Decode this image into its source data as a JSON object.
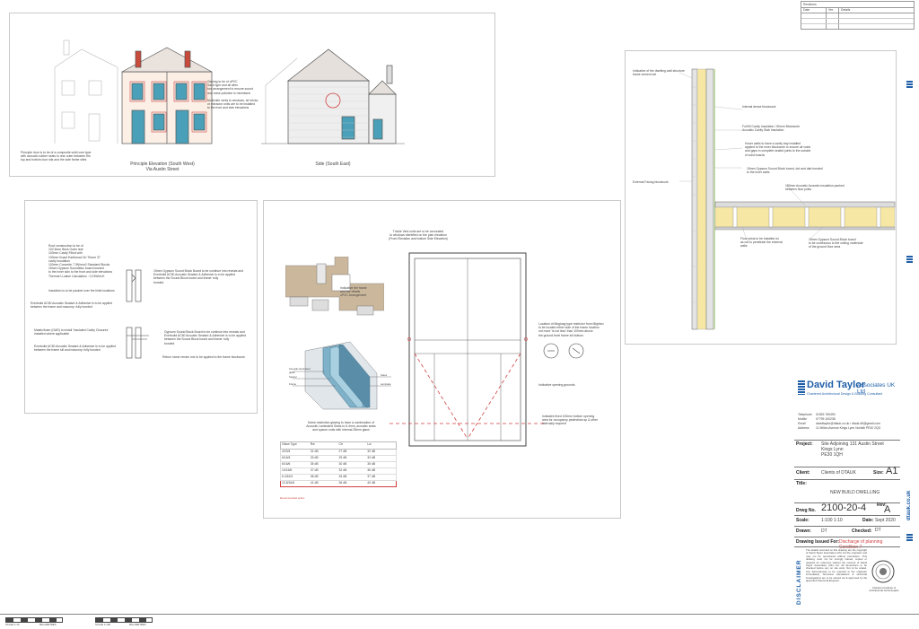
{
  "revision_table": {
    "title": "Revisions",
    "headers": [
      "Date",
      "Ver.",
      "Details"
    ]
  },
  "elevations": {
    "front_caption": "Principle Elevation (South West)\nVia Austin Street",
    "side_caption": "Side (South East)",
    "door_note": "Principle door is to be of a composite solid core type\nwith acoustic rubber seals to rear outer between the\ntop and bottom door sits and the side frame sites",
    "glazing_note": "Glazing to be of uPVC\nSash type and all sites\nbox arrangement to ensure sound\nand noise pollution is minimised\n\nNo trickle vents to windows, air bricks\nor extractor units are to be installed\nto the front and side elevations"
  },
  "wall_section": {
    "roof_notes": "Roof construction to be of\n102.5mm Brick Outer leaf\n100mm Cavity Filled with\n100mm Knauf Earthwool Dri Therm 37\ncavity insulation\n100mm Concrete 7.3N/mm2 Standard Blocks\n15mm Gypsum Soundbloc board bonded\nto the inner skin to the front and side elevations\nThermal U-value Calculation : 0.23W/m²K",
    "gypsum_note": "15mm Gypsum Sound Block Board to be continue into reveals and\nEverbuild AC50 Acoustic Sealant & Adhesive is to be applied\nbetween the Sound Block board and frame: fully\nbonded",
    "insulation_note": "Insulation is to be packed over the lintel locations",
    "sealant_note_1": "Everbuild AC50 Acoustic Sealant & Adhesive is to be applied\nbetween the frame and masonry: fully bonded",
    "cill_note": "Mastic/foam (GAR) to install 'Insulated Cavity Closures'\nInstalled where applicable",
    "sealant_note_2": "Everbuild AC50 Acoustic Sealant & Adhesive is to be applied\nbetween the frame sill and masonry: fully bonded",
    "gypsum_note_2": "Gypsum Sound Block Board to be continue into reveals and\nEverbuild AC50 Acoustic Sealant & Adhesive is to be applied\nbetween the Sound Block board and frame: fully\nbonded",
    "board_note": "Return stone render mix to be applied to the frame blockwork"
  },
  "window_detail": {
    "top_note": "Trickle Vent units are to be concealed\nto windows identified on the plan elevation\n(Front Elevation and bottom Side Elevation)",
    "frame_note": "Indicative the frame\nand bar details\nuPVC Arrangement",
    "restrictor_note": "Location of Mkgloag type restrictor from Mighton\nto be located either side of the frame location\nnot more 'is not less' than 100mm above\nthe ground level frame sill bottom",
    "opening_note": "Indicative opening grounds",
    "sill_note": "Indicates fixed 100mm bottom opening\narea for occupancy pedestrian sp & other\ninternally required",
    "glass_note": "Noise restriction glazing to have a combination of\nAcoustic Laminated Glass to 6.4mm, acoustic seals\nand spacer units with Internal 28mm glass",
    "glass_labels": [
      "Acoustic laminated glass",
      "Spacer",
      "Frame",
      "Glass",
      "Laminate"
    ],
    "table_headers": [
      "Glass Type",
      "Rw",
      "Ctr",
      "Lw"
    ],
    "table_rows": [
      [
        "4/20/4",
        "31 dB",
        "27 dB",
        "32 dB"
      ],
      [
        "6/16/4",
        "33 dB",
        "29 dB",
        "33 dB"
      ],
      [
        "6/16/6",
        "35 dB",
        "30 dB",
        "35 dB"
      ],
      [
        "10/16/6",
        "37 dB",
        "32 dB",
        "36 dB"
      ],
      [
        "6.4/16/4",
        "38 dB",
        "34 dB",
        "37 dB"
      ],
      [
        "10.8/16/6",
        "41 dB",
        "36 dB",
        "40 dB"
      ]
    ],
    "table_footnote": "Recommended option"
  },
  "floor_detail": {
    "notes": [
      "Indicative of the dwelling wall structure\nframe cement set",
      "Internal dense blockwork",
      "Full fill Cavity Insulation / 50mm Blockwork\nAcoustic Cavity Slab Insulation",
      "Hover walls to have a cavity tray installed\napplied to the inner blockwork to ensure all voids\nand gaps in complete sealed joints to the outside\nof solid boards",
      "15mm Gypsum Sound Block board, dot and dab bonded\nto the inner walls",
      "External Facing blockwork",
      "180mm Acoustic Acoustic insulation packed\nbetween floor joists",
      "Floor joists to be installed on\nas not to penetrate the external\nwalls",
      "15mm Gypsum Sound Block board\nto be continuous to the ceiling underside\nof the ground floor area"
    ]
  },
  "title_block": {
    "company_name": "David Taylor",
    "company_suffix": "Associates UK Ltd",
    "company_tagline": "Chartered Architectural Design & Building Consultant",
    "contacts": [
      {
        "label": "Telephone",
        "value": "01553 769490"
      },
      {
        "label": "Mobile",
        "value": "07799 100238"
      },
      {
        "label": "Email",
        "value": "davidtaylor@dtauk.co.uk  /  dtauk.d5@gmail.com"
      },
      {
        "label": "Address",
        "value": "11 Milton Avenue Kings Lynn Norfolk PE30 2QG"
      }
    ],
    "project_label": "Project:",
    "project_value": "Site Adjoining 131 Austin Street\nKings Lynn\nPE30 1QH",
    "client_label": "Client:",
    "client_value": "Clients of DTAUK",
    "size_label": "Size:",
    "size_value": "A1",
    "title_label": "Title:",
    "title_value": "NEW BUILD DWELLING",
    "drwg_label": "Drwg No.",
    "drwg_value": "2100-20-4",
    "rev_label": "Rev:",
    "rev_value": "A",
    "scale_label": "Scale:",
    "scale_value": "1:100  1:10",
    "date_label": "Date:",
    "date_value": "Sept 2020",
    "drawn_label": "Drawn:",
    "drawn_value": "DT",
    "checked_label": "Checked:",
    "checked_value": "DT",
    "issued_label": "Drawing Issued For:",
    "issued_value": "Discharge of planning Condition 7",
    "disclaimer_heading": "DISCLAIMER",
    "disclaimer_text": "The details recorded on this drawing are the copyright of David Taylor Associates (UK) Ltd the originator and may not be reproduced without permission. This drawing must not be wrongly loaned, copied or retained for reference without the consent of David Taylor Associates (UK) Ltd. All dimensions to be checked before any on site work. Not to be scaled. Any discrepancies to be reported to the originator immediately. Structural calculations & structural investigations are to be carried out & approved by the appointed Structural Engineer.",
    "ciat_label": "Chartered Institute of Architectural Technologists",
    "website": "dtauk.co.uk"
  },
  "scale_bars": [
    {
      "label_left": "SCALE 1:10",
      "label_right": "MILLIMETRES"
    },
    {
      "label_left": "SCALE 1:100",
      "label_right": "MILLIMETRES"
    }
  ],
  "colors": {
    "brand_blue": "#1f5fa8",
    "red_accent": "#d04040",
    "insulation_yellow": "#f6e7a5",
    "glass_blue": "#7fb1c9"
  }
}
